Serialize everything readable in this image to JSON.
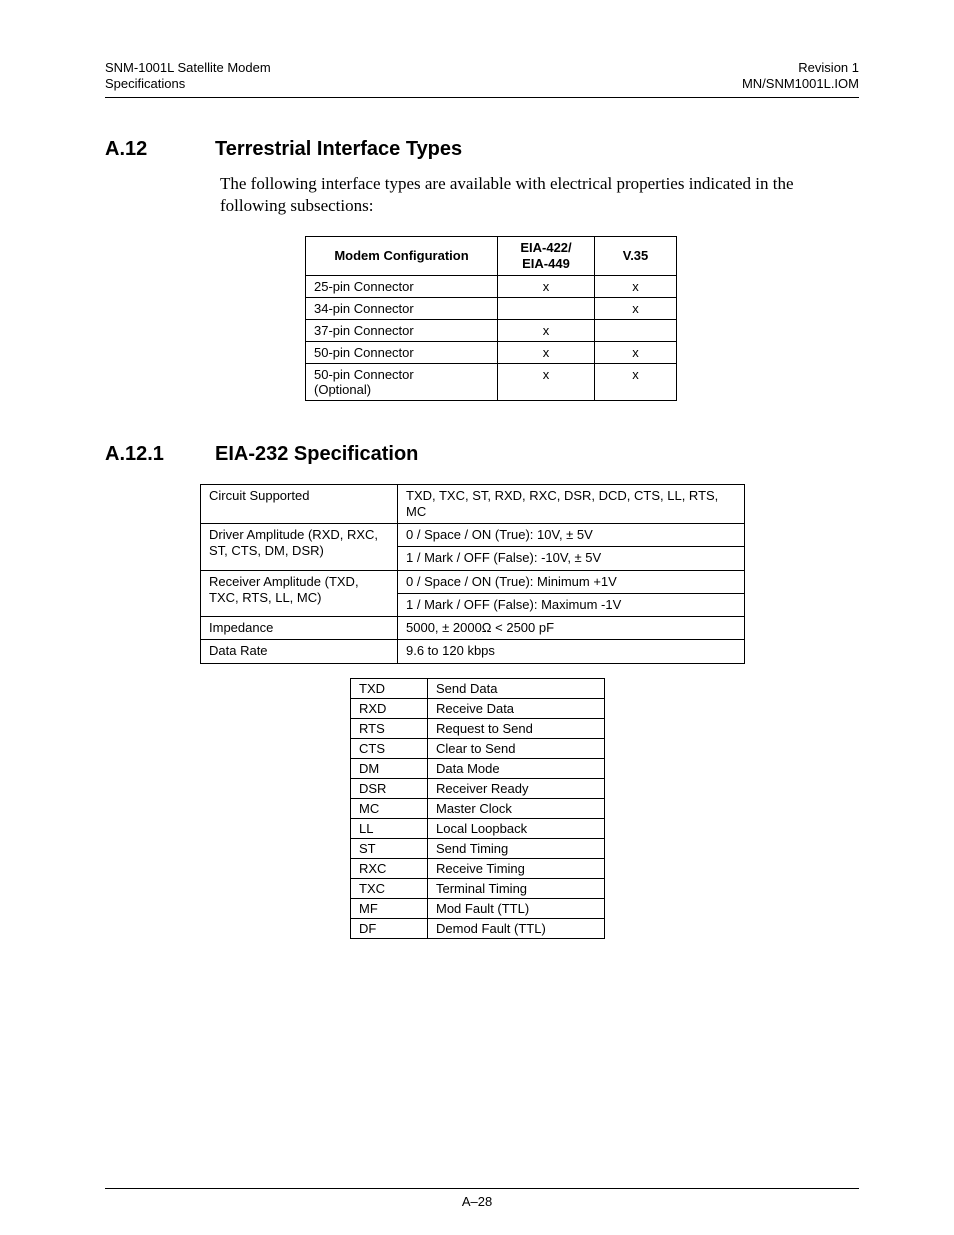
{
  "header": {
    "left_line1": "SNM-1001L Satellite Modem",
    "left_line2": "Specifications",
    "right_line1": "Revision 1",
    "right_line2": "MN/SNM1001L.IOM"
  },
  "section_a12": {
    "number": "A.12",
    "title": "Terrestrial Interface Types",
    "intro": "The following interface types are available with electrical properties indicated in the following subsections:"
  },
  "table1": {
    "head": {
      "c0": "Modem Configuration",
      "c1_l1": "EIA-422/",
      "c1_l2": "EIA-449",
      "c2": "V.35"
    },
    "rows": [
      {
        "c0": "25-pin Connector",
        "c1": "x",
        "c2": "x"
      },
      {
        "c0": "34-pin Connector",
        "c1": "",
        "c2": "x"
      },
      {
        "c0": "37-pin Connector",
        "c1": "x",
        "c2": ""
      },
      {
        "c0": "50-pin Connector",
        "c1": "x",
        "c2": "x"
      },
      {
        "c0_l1": "50-pin Connector",
        "c0_l2": "(Optional)",
        "c1": "x",
        "c2": "x"
      }
    ]
  },
  "section_a12_1": {
    "number": "A.12.1",
    "title": "EIA-232 Specification"
  },
  "table2": {
    "rows": [
      {
        "c0": "Circuit Supported",
        "c1": "TXD, TXC, ST, RXD, RXC, DSR, DCD, CTS, LL, RTS, MC"
      },
      {
        "c0_l1": "Driver Amplitude (RXD, RXC,",
        "c0_l2": "ST, CTS, DM, DSR)",
        "c1_l1": "0 / Space / ON (True): 10V, ± 5V",
        "c1_l2": "1 / Mark / OFF (False): -10V, ± 5V"
      },
      {
        "c0_l1": "Receiver Amplitude (TXD,",
        "c0_l2": "TXC, RTS, LL, MC)",
        "c1_l1": "0 / Space / ON (True): Minimum +1V",
        "c1_l2": "1 / Mark / OFF (False): Maximum -1V"
      },
      {
        "c0": "Impedance",
        "c1": "5000, ± 2000Ω < 2500 pF"
      },
      {
        "c0": "Data Rate",
        "c1": "9.6 to 120 kbps"
      }
    ]
  },
  "table3": {
    "rows": [
      {
        "c0": "TXD",
        "c1": "Send Data"
      },
      {
        "c0": "RXD",
        "c1": "Receive Data"
      },
      {
        "c0": "RTS",
        "c1": "Request to Send"
      },
      {
        "c0": "CTS",
        "c1": "Clear to Send"
      },
      {
        "c0": "DM",
        "c1": "Data Mode"
      },
      {
        "c0": "DSR",
        "c1": "Receiver Ready"
      },
      {
        "c0": "MC",
        "c1": "Master Clock"
      },
      {
        "c0": "LL",
        "c1": "Local Loopback"
      },
      {
        "c0": "ST",
        "c1": "Send Timing"
      },
      {
        "c0": "RXC",
        "c1": "Receive Timing"
      },
      {
        "c0": "TXC",
        "c1": "Terminal Timing"
      },
      {
        "c0": "MF",
        "c1": "Mod Fault (TTL)"
      },
      {
        "c0": "DF",
        "c1": "Demod Fault (TTL)"
      }
    ]
  },
  "page_number": "A–28"
}
